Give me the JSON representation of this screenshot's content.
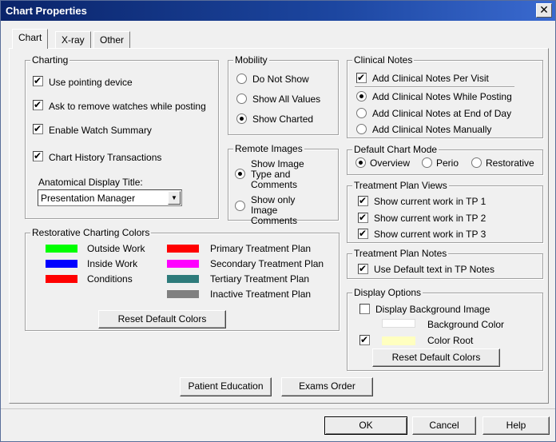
{
  "window": {
    "title": "Chart Properties",
    "close_glyph": "✕"
  },
  "tabs": [
    {
      "label": "Chart",
      "active": true
    },
    {
      "label": "X-ray",
      "active": false
    },
    {
      "label": "Other",
      "active": false
    }
  ],
  "charting": {
    "legend": "Charting",
    "options": [
      {
        "label": "Use pointing device",
        "checked": true
      },
      {
        "label": "Ask to remove watches while posting",
        "checked": true
      },
      {
        "label": "Enable Watch Summary",
        "checked": true
      },
      {
        "label": "Chart History Transactions",
        "checked": true
      }
    ],
    "anatomical_label": "Anatomical Display Title:",
    "anatomical_value": "Presentation Manager"
  },
  "mobility": {
    "legend": "Mobility",
    "options": [
      {
        "label": "Do Not Show",
        "selected": false
      },
      {
        "label": "Show All Values",
        "selected": false
      },
      {
        "label": "Show Charted",
        "selected": true
      }
    ]
  },
  "remote_images": {
    "legend": "Remote Images",
    "options": [
      {
        "label": "Show Image Type and Comments",
        "selected": true
      },
      {
        "label": "Show only Image Comments",
        "selected": false
      }
    ]
  },
  "clinical_notes": {
    "legend": "Clinical Notes",
    "per_visit": {
      "label": "Add Clinical Notes Per Visit",
      "checked": true
    },
    "options": [
      {
        "label": "Add Clinical Notes While Posting",
        "selected": true
      },
      {
        "label": "Add Clinical Notes at End of Day",
        "selected": false
      },
      {
        "label": "Add Clinical Notes Manually",
        "selected": false
      }
    ]
  },
  "default_chart_mode": {
    "legend": "Default Chart Mode",
    "options": [
      {
        "label": "Overview",
        "selected": true
      },
      {
        "label": "Perio",
        "selected": false
      },
      {
        "label": "Restorative",
        "selected": false
      }
    ]
  },
  "treatment_plan_views": {
    "legend": "Treatment Plan Views",
    "options": [
      {
        "label": "Show current work in TP 1",
        "checked": true
      },
      {
        "label": "Show current work in TP 2",
        "checked": true
      },
      {
        "label": "Show current work in TP 3",
        "checked": true
      }
    ]
  },
  "treatment_plan_notes": {
    "legend": "Treatment Plan Notes",
    "option": {
      "label": "Use Default text in TP Notes",
      "checked": true
    }
  },
  "display_options": {
    "legend": "Display Options",
    "background_image": {
      "label": "Display Background Image",
      "checked": false
    },
    "background_color": {
      "label": "Background Color",
      "color": "#ffffff"
    },
    "color_root": {
      "label": "Color Root",
      "checked": true,
      "color": "#ffffc0"
    },
    "reset_label": "Reset Default Colors"
  },
  "restorative_colors": {
    "legend": "Restorative Charting Colors",
    "left": [
      {
        "label": "Outside Work",
        "color": "#00ff00"
      },
      {
        "label": "Inside Work",
        "color": "#0000ff"
      },
      {
        "label": "Conditions",
        "color": "#ff0000"
      }
    ],
    "right": [
      {
        "label": "Primary Treatment Plan",
        "color": "#ff0000"
      },
      {
        "label": "Secondary Treatment Plan",
        "color": "#ff00ff"
      },
      {
        "label": "Tertiary Treatment Plan",
        "color": "#2e7b7b"
      },
      {
        "label": "Inactive Treatment Plan",
        "color": "#808080"
      }
    ],
    "reset_label": "Reset Default Colors"
  },
  "actions": {
    "patient_education": "Patient Education",
    "exams_order": "Exams Order"
  },
  "dialog_buttons": {
    "ok": "OK",
    "cancel": "Cancel",
    "help": "Help"
  }
}
